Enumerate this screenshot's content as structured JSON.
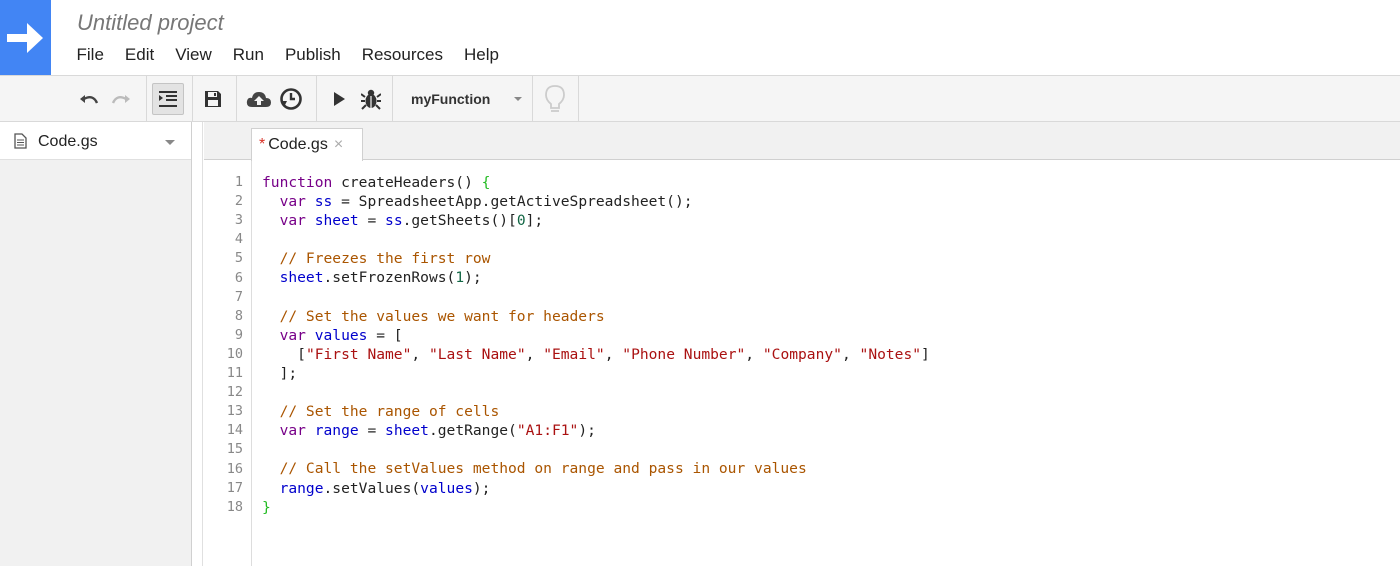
{
  "header": {
    "project_title": "Untitled project",
    "logo_icon": "arrow-right-icon",
    "accent_color": "#4285f4"
  },
  "menu": [
    "File",
    "Edit",
    "View",
    "Run",
    "Publish",
    "Resources",
    "Help"
  ],
  "toolbar": {
    "buttons": [
      "undo-icon",
      "redo-icon",
      "indent-icon",
      "save-icon",
      "cloud-publish-icon",
      "clock-triggers-icon",
      "run-icon",
      "debug-bug-icon",
      "lightbulb-icon"
    ],
    "function_select": "myFunction"
  },
  "sidebar": {
    "file_name": "Code.gs"
  },
  "tab": {
    "modified_marker": "*",
    "label": "Code.gs",
    "close": "×"
  },
  "editor": {
    "line_numbers": [
      "1",
      "2",
      "3",
      "4",
      "5",
      "6",
      "7",
      "8",
      "9",
      "10",
      "11",
      "12",
      "13",
      "14",
      "15",
      "16",
      "17",
      "18"
    ],
    "lines": [
      [
        {
          "t": "kw",
          "v": "function"
        },
        {
          "t": "pl",
          "v": " createHeaders() "
        },
        {
          "t": "br",
          "v": "{"
        }
      ],
      [
        {
          "t": "pl",
          "v": "  "
        },
        {
          "t": "kw",
          "v": "var"
        },
        {
          "t": "pl",
          "v": " "
        },
        {
          "t": "def",
          "v": "ss"
        },
        {
          "t": "pl",
          "v": " = SpreadsheetApp.getActiveSpreadsheet();"
        }
      ],
      [
        {
          "t": "pl",
          "v": "  "
        },
        {
          "t": "kw",
          "v": "var"
        },
        {
          "t": "pl",
          "v": " "
        },
        {
          "t": "def",
          "v": "sheet"
        },
        {
          "t": "pl",
          "v": " = "
        },
        {
          "t": "def",
          "v": "ss"
        },
        {
          "t": "pl",
          "v": ".getSheets()["
        },
        {
          "t": "num",
          "v": "0"
        },
        {
          "t": "pl",
          "v": "];"
        }
      ],
      [
        {
          "t": "pl",
          "v": ""
        }
      ],
      [
        {
          "t": "pl",
          "v": "  "
        },
        {
          "t": "com",
          "v": "// Freezes the first row"
        }
      ],
      [
        {
          "t": "pl",
          "v": "  "
        },
        {
          "t": "def",
          "v": "sheet"
        },
        {
          "t": "pl",
          "v": ".setFrozenRows("
        },
        {
          "t": "num",
          "v": "1"
        },
        {
          "t": "pl",
          "v": ");"
        }
      ],
      [
        {
          "t": "pl",
          "v": ""
        }
      ],
      [
        {
          "t": "pl",
          "v": "  "
        },
        {
          "t": "com",
          "v": "// Set the values we want for headers"
        }
      ],
      [
        {
          "t": "pl",
          "v": "  "
        },
        {
          "t": "kw",
          "v": "var"
        },
        {
          "t": "pl",
          "v": " "
        },
        {
          "t": "def",
          "v": "values"
        },
        {
          "t": "pl",
          "v": " = ["
        }
      ],
      [
        {
          "t": "pl",
          "v": "    ["
        },
        {
          "t": "str",
          "v": "\"First Name\""
        },
        {
          "t": "pl",
          "v": ", "
        },
        {
          "t": "str",
          "v": "\"Last Name\""
        },
        {
          "t": "pl",
          "v": ", "
        },
        {
          "t": "str",
          "v": "\"Email\""
        },
        {
          "t": "pl",
          "v": ", "
        },
        {
          "t": "str",
          "v": "\"Phone Number\""
        },
        {
          "t": "pl",
          "v": ", "
        },
        {
          "t": "str",
          "v": "\"Company\""
        },
        {
          "t": "pl",
          "v": ", "
        },
        {
          "t": "str",
          "v": "\"Notes\""
        },
        {
          "t": "pl",
          "v": "]"
        }
      ],
      [
        {
          "t": "pl",
          "v": "  ];"
        }
      ],
      [
        {
          "t": "pl",
          "v": ""
        }
      ],
      [
        {
          "t": "pl",
          "v": "  "
        },
        {
          "t": "com",
          "v": "// Set the range of cells"
        }
      ],
      [
        {
          "t": "pl",
          "v": "  "
        },
        {
          "t": "kw",
          "v": "var"
        },
        {
          "t": "pl",
          "v": " "
        },
        {
          "t": "def",
          "v": "range"
        },
        {
          "t": "pl",
          "v": " = "
        },
        {
          "t": "def",
          "v": "sheet"
        },
        {
          "t": "pl",
          "v": ".getRange("
        },
        {
          "t": "str",
          "v": "\"A1:F1\""
        },
        {
          "t": "pl",
          "v": ");"
        }
      ],
      [
        {
          "t": "pl",
          "v": ""
        }
      ],
      [
        {
          "t": "pl",
          "v": "  "
        },
        {
          "t": "com",
          "v": "// Call the setValues method on range and pass in our values"
        }
      ],
      [
        {
          "t": "pl",
          "v": "  "
        },
        {
          "t": "def",
          "v": "range"
        },
        {
          "t": "pl",
          "v": ".setValues("
        },
        {
          "t": "def",
          "v": "values"
        },
        {
          "t": "pl",
          "v": ");"
        }
      ],
      [
        {
          "t": "br",
          "v": "}"
        }
      ]
    ]
  }
}
